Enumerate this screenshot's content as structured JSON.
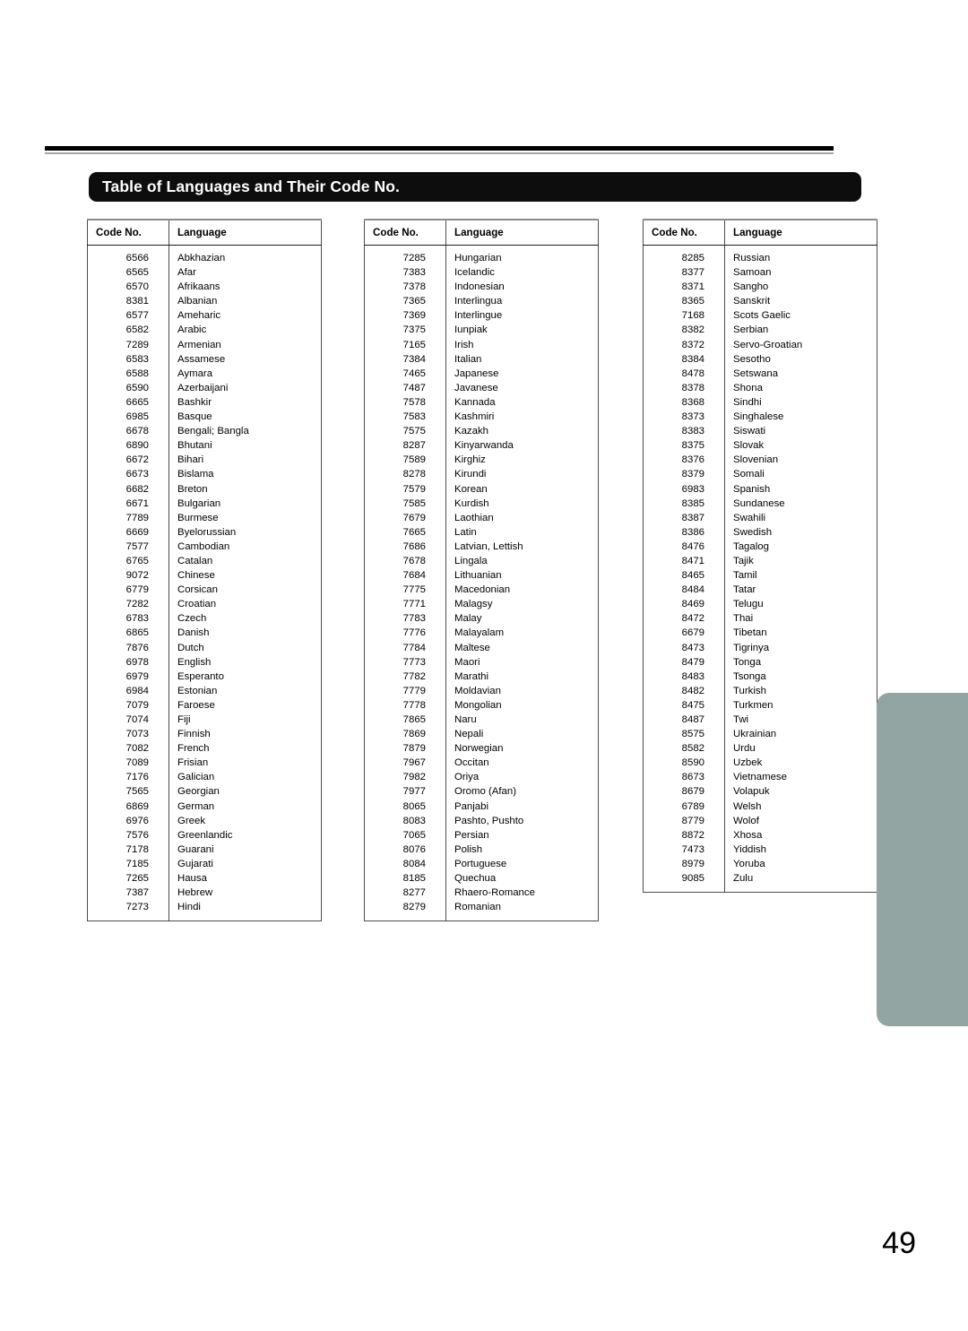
{
  "page": {
    "title": "Table of Languages and Their Code No.",
    "page_number": "49",
    "side_tab_color": "#93a5a2",
    "title_bar_color": "#0d0d0d"
  },
  "table_headers": {
    "code": "Code No.",
    "language": "Language"
  },
  "columns": [
    {
      "id": "column-1",
      "rows": [
        {
          "code": "6566",
          "language": "Abkhazian"
        },
        {
          "code": "6565",
          "language": "Afar"
        },
        {
          "code": "6570",
          "language": "Afrikaans"
        },
        {
          "code": "8381",
          "language": "Albanian"
        },
        {
          "code": "6577",
          "language": "Ameharic"
        },
        {
          "code": "6582",
          "language": "Arabic"
        },
        {
          "code": "7289",
          "language": "Armenian"
        },
        {
          "code": "6583",
          "language": "Assamese"
        },
        {
          "code": "6588",
          "language": "Aymara"
        },
        {
          "code": "6590",
          "language": "Azerbaijani"
        },
        {
          "code": "6665",
          "language": "Bashkir"
        },
        {
          "code": "6985",
          "language": "Basque"
        },
        {
          "code": "6678",
          "language": "Bengali; Bangla"
        },
        {
          "code": "6890",
          "language": "Bhutani"
        },
        {
          "code": "6672",
          "language": "Bihari"
        },
        {
          "code": "6673",
          "language": "Bislama"
        },
        {
          "code": "6682",
          "language": "Breton"
        },
        {
          "code": "6671",
          "language": "Bulgarian"
        },
        {
          "code": "7789",
          "language": "Burmese"
        },
        {
          "code": "6669",
          "language": "Byelorussian"
        },
        {
          "code": "7577",
          "language": "Cambodian"
        },
        {
          "code": "6765",
          "language": "Catalan"
        },
        {
          "code": "9072",
          "language": "Chinese"
        },
        {
          "code": "6779",
          "language": "Corsican"
        },
        {
          "code": "7282",
          "language": "Croatian"
        },
        {
          "code": "6783",
          "language": "Czech"
        },
        {
          "code": "6865",
          "language": "Danish"
        },
        {
          "code": "7876",
          "language": "Dutch"
        },
        {
          "code": "6978",
          "language": "English"
        },
        {
          "code": "6979",
          "language": "Esperanto"
        },
        {
          "code": "6984",
          "language": "Estonian"
        },
        {
          "code": "7079",
          "language": "Faroese"
        },
        {
          "code": "7074",
          "language": "Fiji"
        },
        {
          "code": "7073",
          "language": "Finnish"
        },
        {
          "code": "7082",
          "language": "French"
        },
        {
          "code": "7089",
          "language": "Frisian"
        },
        {
          "code": "7176",
          "language": "Galician"
        },
        {
          "code": "7565",
          "language": "Georgian"
        },
        {
          "code": "6869",
          "language": "German"
        },
        {
          "code": "6976",
          "language": "Greek"
        },
        {
          "code": "7576",
          "language": "Greenlandic"
        },
        {
          "code": "7178",
          "language": "Guarani"
        },
        {
          "code": "7185",
          "language": "Gujarati"
        },
        {
          "code": "7265",
          "language": "Hausa"
        },
        {
          "code": "7387",
          "language": "Hebrew"
        },
        {
          "code": "7273",
          "language": "Hindi"
        }
      ]
    },
    {
      "id": "column-2",
      "rows": [
        {
          "code": "7285",
          "language": "Hungarian"
        },
        {
          "code": "7383",
          "language": "Icelandic"
        },
        {
          "code": "7378",
          "language": "Indonesian"
        },
        {
          "code": "7365",
          "language": "Interlingua"
        },
        {
          "code": "7369",
          "language": "Interlingue"
        },
        {
          "code": "7375",
          "language": "Iunpiak"
        },
        {
          "code": "7165",
          "language": "Irish"
        },
        {
          "code": "7384",
          "language": "Italian"
        },
        {
          "code": "7465",
          "language": "Japanese"
        },
        {
          "code": "7487",
          "language": "Javanese"
        },
        {
          "code": "7578",
          "language": "Kannada"
        },
        {
          "code": "7583",
          "language": "Kashmiri"
        },
        {
          "code": "7575",
          "language": "Kazakh"
        },
        {
          "code": "8287",
          "language": "Kinyarwanda"
        },
        {
          "code": "7589",
          "language": "Kirghiz"
        },
        {
          "code": "8278",
          "language": "Kirundi"
        },
        {
          "code": "7579",
          "language": "Korean"
        },
        {
          "code": "7585",
          "language": "Kurdish"
        },
        {
          "code": "7679",
          "language": "Laothian"
        },
        {
          "code": "7665",
          "language": "Latin"
        },
        {
          "code": "7686",
          "language": "Latvian, Lettish"
        },
        {
          "code": "7678",
          "language": "Lingala"
        },
        {
          "code": "7684",
          "language": "Lithuanian"
        },
        {
          "code": "7775",
          "language": "Macedonian"
        },
        {
          "code": "7771",
          "language": "Malagsy"
        },
        {
          "code": "7783",
          "language": "Malay"
        },
        {
          "code": "7776",
          "language": "Malayalam"
        },
        {
          "code": "7784",
          "language": "Maltese"
        },
        {
          "code": "7773",
          "language": "Maori"
        },
        {
          "code": "7782",
          "language": "Marathi"
        },
        {
          "code": "7779",
          "language": "Moldavian"
        },
        {
          "code": "7778",
          "language": "Mongolian"
        },
        {
          "code": "7865",
          "language": "Naru"
        },
        {
          "code": "7869",
          "language": "Nepali"
        },
        {
          "code": "7879",
          "language": "Norwegian"
        },
        {
          "code": "7967",
          "language": "Occitan"
        },
        {
          "code": "7982",
          "language": "Oriya"
        },
        {
          "code": "7977",
          "language": "Oromo (Afan)"
        },
        {
          "code": "8065",
          "language": "Panjabi"
        },
        {
          "code": "8083",
          "language": "Pashto, Pushto"
        },
        {
          "code": "7065",
          "language": "Persian"
        },
        {
          "code": "8076",
          "language": "Polish"
        },
        {
          "code": "8084",
          "language": "Portuguese"
        },
        {
          "code": "8185",
          "language": "Quechua"
        },
        {
          "code": "8277",
          "language": "Rhaero-Romance"
        },
        {
          "code": "8279",
          "language": "Romanian"
        }
      ]
    },
    {
      "id": "column-3",
      "rows": [
        {
          "code": "8285",
          "language": "Russian"
        },
        {
          "code": "8377",
          "language": "Samoan"
        },
        {
          "code": "8371",
          "language": "Sangho"
        },
        {
          "code": "8365",
          "language": "Sanskrit"
        },
        {
          "code": "7168",
          "language": "Scots Gaelic"
        },
        {
          "code": "8382",
          "language": "Serbian"
        },
        {
          "code": "8372",
          "language": "Servo-Groatian"
        },
        {
          "code": "8384",
          "language": "Sesotho"
        },
        {
          "code": "8478",
          "language": "Setswana"
        },
        {
          "code": "8378",
          "language": "Shona"
        },
        {
          "code": "8368",
          "language": "Sindhi"
        },
        {
          "code": "8373",
          "language": "Singhalese"
        },
        {
          "code": "8383",
          "language": "Siswati"
        },
        {
          "code": "8375",
          "language": "Slovak"
        },
        {
          "code": "8376",
          "language": "Slovenian"
        },
        {
          "code": "8379",
          "language": "Somali"
        },
        {
          "code": "6983",
          "language": "Spanish"
        },
        {
          "code": "8385",
          "language": "Sundanese"
        },
        {
          "code": "8387",
          "language": "Swahili"
        },
        {
          "code": "8386",
          "language": "Swedish"
        },
        {
          "code": "8476",
          "language": "Tagalog"
        },
        {
          "code": "8471",
          "language": "Tajik"
        },
        {
          "code": "8465",
          "language": "Tamil"
        },
        {
          "code": "8484",
          "language": "Tatar"
        },
        {
          "code": "8469",
          "language": "Telugu"
        },
        {
          "code": "8472",
          "language": "Thai"
        },
        {
          "code": "6679",
          "language": "Tibetan"
        },
        {
          "code": "8473",
          "language": "Tigrinya"
        },
        {
          "code": "8479",
          "language": "Tonga"
        },
        {
          "code": "8483",
          "language": "Tsonga"
        },
        {
          "code": "8482",
          "language": "Turkish"
        },
        {
          "code": "8475",
          "language": "Turkmen"
        },
        {
          "code": "8487",
          "language": "Twi"
        },
        {
          "code": "8575",
          "language": "Ukrainian"
        },
        {
          "code": "8582",
          "language": "Urdu"
        },
        {
          "code": "8590",
          "language": "Uzbek"
        },
        {
          "code": "8673",
          "language": "Vietnamese"
        },
        {
          "code": "8679",
          "language": "Volapuk"
        },
        {
          "code": "6789",
          "language": "Welsh"
        },
        {
          "code": "8779",
          "language": "Wolof"
        },
        {
          "code": "8872",
          "language": "Xhosa"
        },
        {
          "code": "7473",
          "language": "Yiddish"
        },
        {
          "code": "8979",
          "language": "Yoruba"
        },
        {
          "code": "9085",
          "language": "Zulu"
        }
      ]
    }
  ]
}
